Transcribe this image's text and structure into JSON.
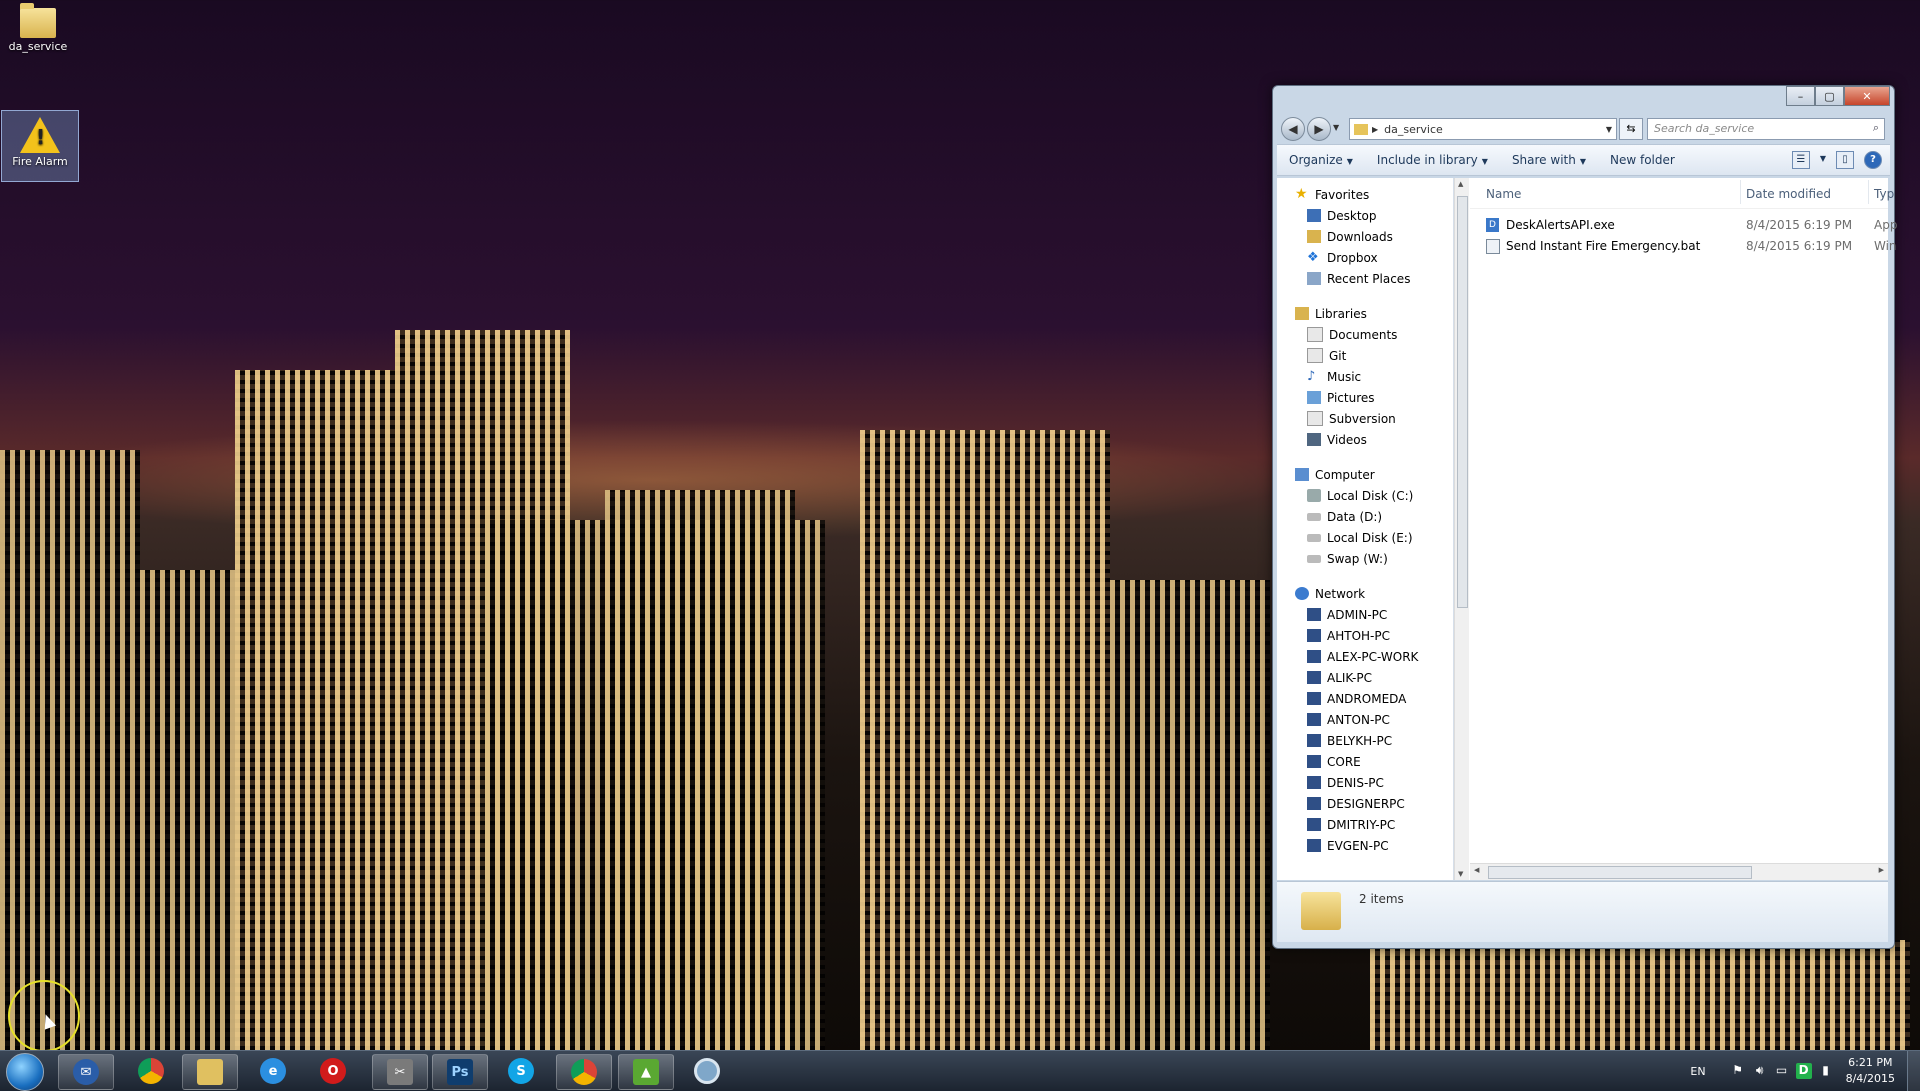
{
  "desktop": {
    "icons": [
      {
        "label": "da_service",
        "icon": "folder-icon"
      },
      {
        "label": "Fire Alarm",
        "icon": "warning-icon"
      }
    ]
  },
  "explorer": {
    "address": {
      "path_segment": "da_service"
    },
    "search": {
      "placeholder": "Search da_service"
    },
    "commands": {
      "organize": "Organize",
      "include_in_library": "Include in library",
      "share_with": "Share with",
      "new_folder": "New folder"
    },
    "nav": {
      "favorites": {
        "label": "Favorites",
        "items": [
          "Desktop",
          "Downloads",
          "Dropbox",
          "Recent Places"
        ]
      },
      "libraries": {
        "label": "Libraries",
        "items": [
          "Documents",
          "Git",
          "Music",
          "Pictures",
          "Subversion",
          "Videos"
        ]
      },
      "computer": {
        "label": "Computer",
        "items": [
          "Local Disk (C:)",
          "Data (D:)",
          "Local Disk (E:)",
          "Swap (W:)"
        ]
      },
      "network": {
        "label": "Network",
        "items": [
          "ADMIN-PC",
          "AHTOH-PC",
          "ALEX-PC-WORK",
          "ALIK-PC",
          "ANDROMEDA",
          "ANTON-PC",
          "BELYKH-PC",
          "CORE",
          "DENIS-PC",
          "DESIGNERPC",
          "DMITRIY-PC",
          "EVGEN-PC"
        ]
      }
    },
    "columns": {
      "name": "Name",
      "date_modified": "Date modified",
      "type": "Typ"
    },
    "files": [
      {
        "name": "DeskAlertsAPI.exe",
        "date": "8/4/2015 6:19 PM",
        "type": "App"
      },
      {
        "name": "Send Instant Fire Emergency.bat",
        "date": "8/4/2015 6:19 PM",
        "type": "Win"
      }
    ],
    "status": {
      "items": "2 items"
    }
  },
  "taskbar": {
    "apps": [
      "thunderbird-icon",
      "chrome-icon",
      "explorer-icon",
      "internet-explorer-icon",
      "opera-icon",
      "tools-icon",
      "photoshop-icon",
      "skype-icon",
      "chrome-icon",
      "monitor-icon",
      "circle-app-icon"
    ],
    "ps_label": "Ps",
    "skype_label": "S",
    "tray": {
      "lang": "EN",
      "time": "6:21 PM",
      "date": "8/4/2015",
      "d_label": "D"
    }
  }
}
